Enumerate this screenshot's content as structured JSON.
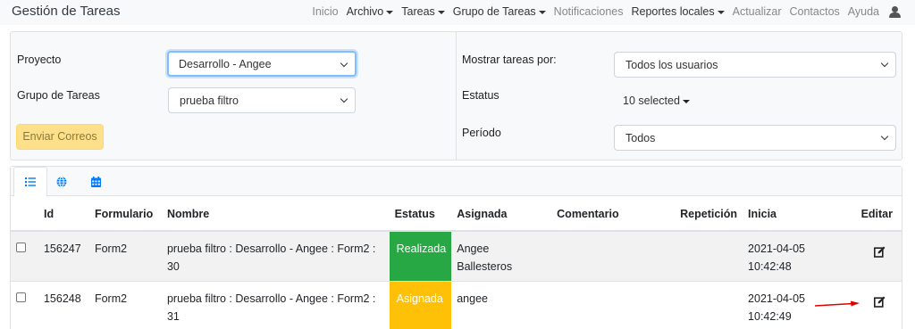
{
  "navbar": {
    "brand": "Gestión de Tareas",
    "items": [
      {
        "label": "Inicio",
        "dropdown": false
      },
      {
        "label": "Archivo",
        "dropdown": true
      },
      {
        "label": "Tareas",
        "dropdown": true
      },
      {
        "label": "Grupo de Tareas",
        "dropdown": true
      },
      {
        "label": "Notificaciones",
        "dropdown": false
      },
      {
        "label": "Reportes locales",
        "dropdown": true
      },
      {
        "label": "Actualizar",
        "dropdown": false
      },
      {
        "label": "Contactos",
        "dropdown": false
      },
      {
        "label": "Ayuda",
        "dropdown": false
      }
    ],
    "user_icon": "user-icon"
  },
  "filters": {
    "proyecto_label": "Proyecto",
    "proyecto_value": "Desarrollo - Angee",
    "grupo_label": "Grupo de Tareas",
    "grupo_value": "prueba filtro",
    "enviar_label": "Enviar Correos",
    "mostrar_label": "Mostrar tareas por:",
    "mostrar_value": "Todos los usuarios",
    "estatus_label": "Estatus",
    "estatus_value": "10 selected",
    "periodo_label": "Período",
    "periodo_value": "Todos"
  },
  "tabs": [
    {
      "icon": "list-icon",
      "active": true
    },
    {
      "icon": "globe-icon",
      "active": false
    },
    {
      "icon": "calendar-icon",
      "active": false
    }
  ],
  "table": {
    "headers": {
      "id": "Id",
      "formulario": "Formulario",
      "nombre": "Nombre",
      "estatus": "Estatus",
      "asignada": "Asignada",
      "comentario": "Comentario",
      "repeticion": "Repetición",
      "inicia": "Inicia",
      "editar": "Editar"
    },
    "rows": [
      {
        "id": "156247",
        "formulario": "Form2",
        "nombre": "prueba filtro : Desarrollo - Angee : Form2 : 30",
        "estatus": "Realizada",
        "estatus_color": "#28a745",
        "asignada": "Angee Ballesteros",
        "comentario": "",
        "repeticion": "",
        "inicia": "2021-04-05 10:42:48",
        "edit_icon": "edit-icon"
      },
      {
        "id": "156248",
        "formulario": "Form2",
        "nombre": "prueba filtro : Desarrollo - Angee : Form2 : 31",
        "estatus": "Asignada",
        "estatus_color": "#ffc107",
        "asignada": "angee",
        "comentario": "",
        "repeticion": "",
        "inicia": "2021-04-05 10:42:49",
        "edit_icon": "edit-icon"
      }
    ]
  },
  "colors": {
    "accent": "#007bff",
    "annotation_arrow": "#e00000",
    "warning_button": "#ffe08a"
  }
}
